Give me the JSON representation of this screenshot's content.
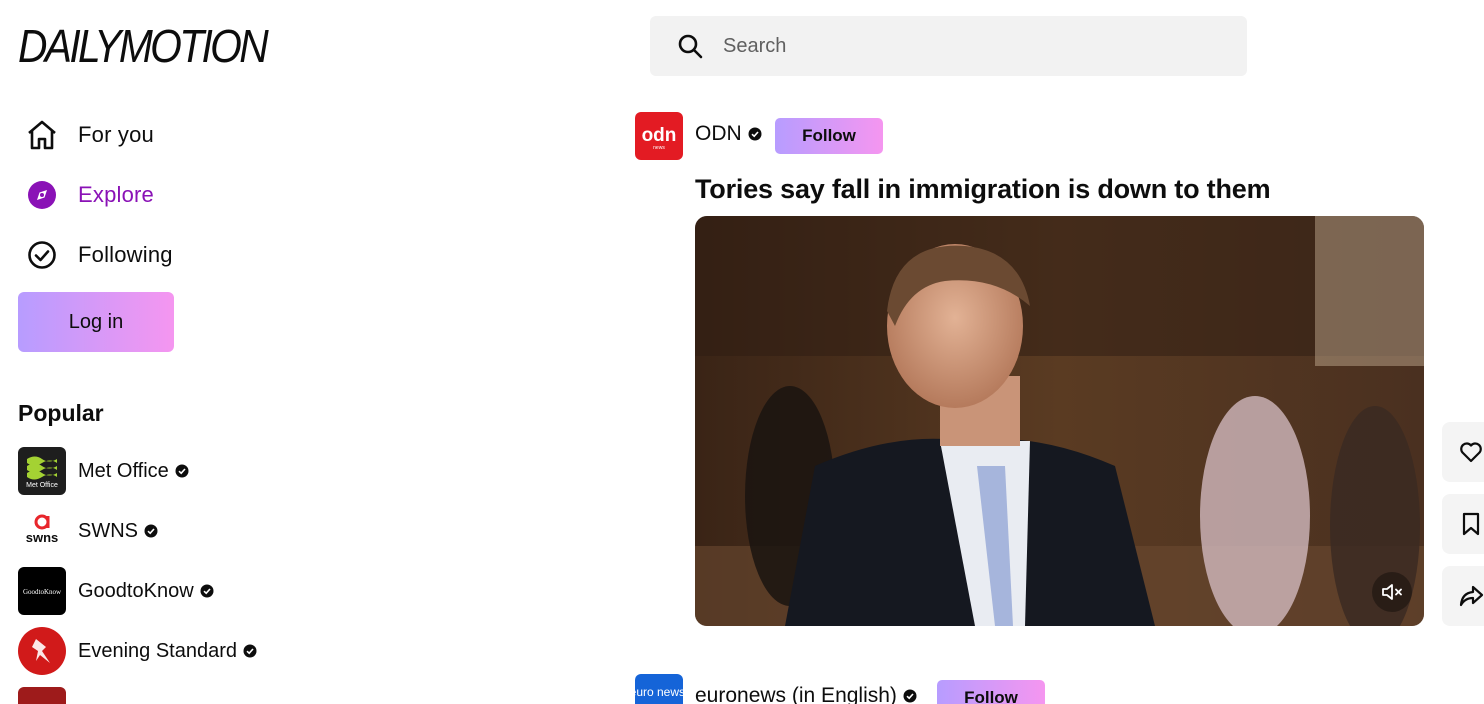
{
  "brand": {
    "logo_text": "DAILYMOTION"
  },
  "nav": {
    "items": [
      {
        "label": "For you",
        "icon": "home-icon"
      },
      {
        "label": "Explore",
        "icon": "compass-icon",
        "active": true
      },
      {
        "label": "Following",
        "icon": "check-circle-icon"
      }
    ],
    "login_label": "Log in",
    "accent_color": "#8a12b6"
  },
  "popular": {
    "heading": "Popular",
    "channels": [
      {
        "name": "Met Office",
        "verified": true,
        "avatar_text": "Met Office"
      },
      {
        "name": "SWNS",
        "verified": true,
        "avatar_text": "swns"
      },
      {
        "name": "GoodtoKnow",
        "verified": true,
        "avatar_text": "GoodtoKnow"
      },
      {
        "name": "Evening Standard",
        "verified": true,
        "avatar_text": ""
      }
    ]
  },
  "search": {
    "placeholder": "Search"
  },
  "feed": {
    "posts": [
      {
        "channel": "ODN",
        "avatar_text": "odn",
        "avatar_subtext": "news",
        "verified": true,
        "follow_label": "Follow",
        "title": "Tories say fall in immigration is down to them"
      },
      {
        "channel": "euronews (in English)",
        "avatar_text": "euro news.",
        "verified": true,
        "follow_label": "Follow"
      }
    ]
  },
  "actions": [
    "heart-icon",
    "bookmark-icon",
    "share-icon"
  ],
  "colors": {
    "follow_gradient_start": "#b79cff",
    "follow_gradient_end": "#f596f0"
  }
}
